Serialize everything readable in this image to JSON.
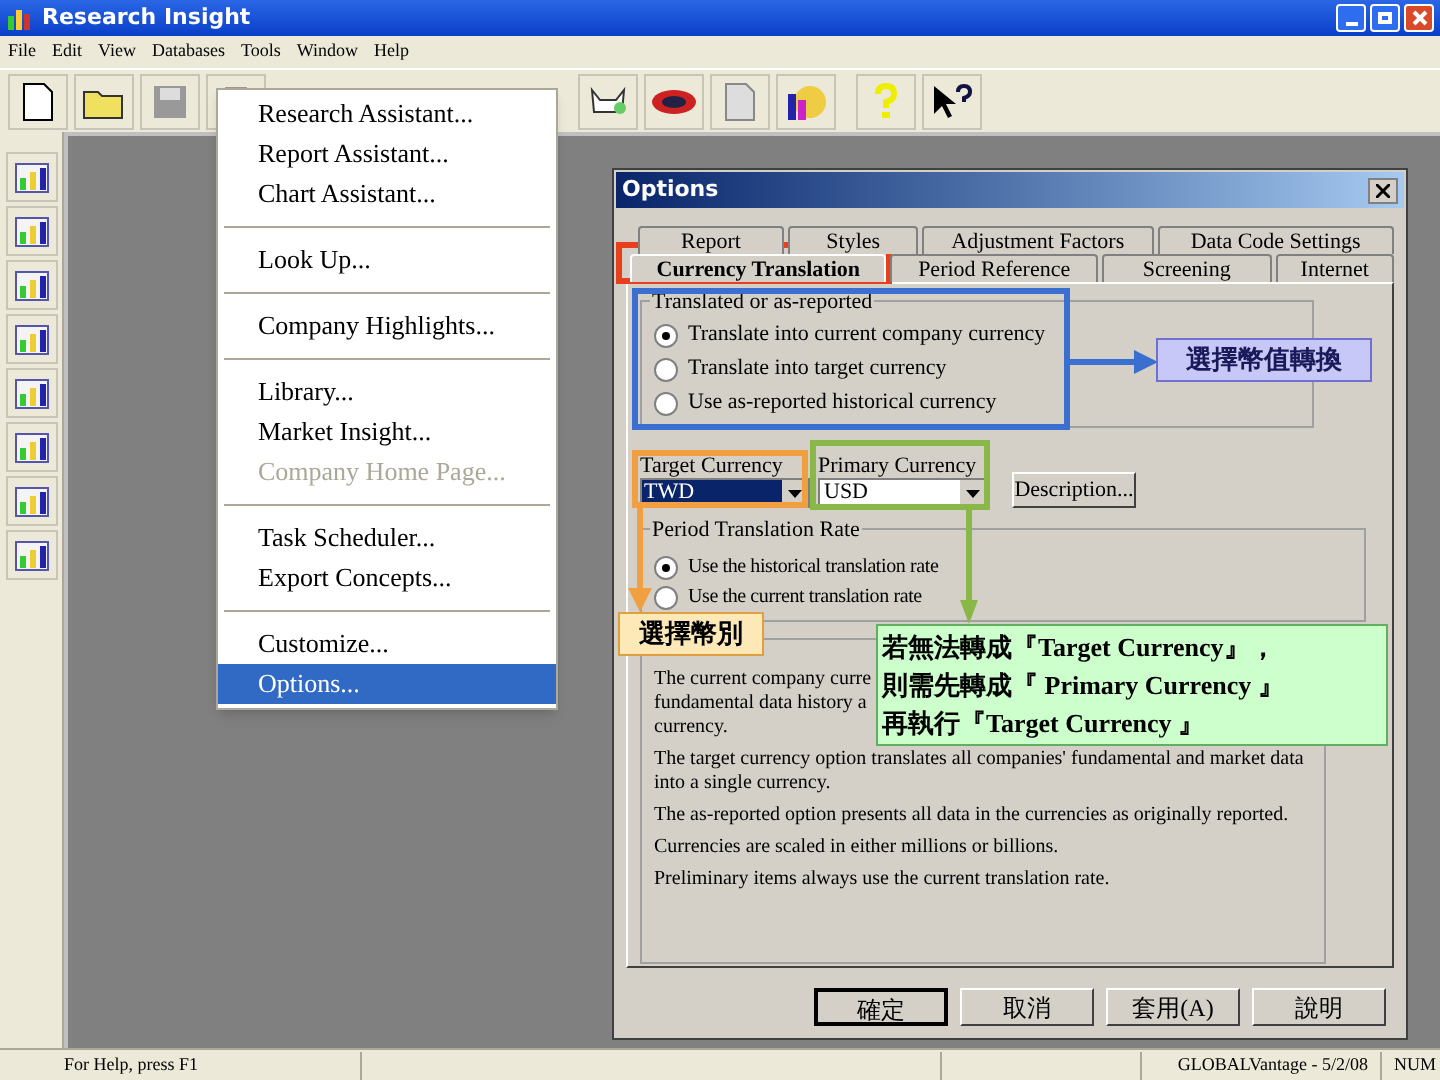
{
  "window": {
    "title": "Research Insight"
  },
  "menu_bar": [
    "File",
    "Edit",
    "View",
    "Databases",
    "Tools",
    "Window",
    "Help"
  ],
  "tools_menu": {
    "items": [
      {
        "kind": "item",
        "label": "Research Assistant...",
        "disabled": false,
        "selected": false
      },
      {
        "kind": "item",
        "label": "Report Assistant...",
        "disabled": false,
        "selected": false
      },
      {
        "kind": "item",
        "label": "Chart Assistant...",
        "disabled": false,
        "selected": false
      },
      {
        "kind": "separator"
      },
      {
        "kind": "item",
        "label": "Look Up...",
        "disabled": false,
        "selected": false
      },
      {
        "kind": "separator"
      },
      {
        "kind": "item",
        "label": "Company Highlights...",
        "disabled": false,
        "selected": false
      },
      {
        "kind": "separator"
      },
      {
        "kind": "item",
        "label": "Library...",
        "disabled": false,
        "selected": false
      },
      {
        "kind": "item",
        "label": "Market Insight...",
        "disabled": false,
        "selected": false
      },
      {
        "kind": "item",
        "label": "Company Home Page...",
        "disabled": true,
        "selected": false
      },
      {
        "kind": "separator"
      },
      {
        "kind": "item",
        "label": "Task Scheduler...",
        "disabled": false,
        "selected": false
      },
      {
        "kind": "item",
        "label": "Export Concepts...",
        "disabled": false,
        "selected": false
      },
      {
        "kind": "separator"
      },
      {
        "kind": "item",
        "label": "Customize...",
        "disabled": false,
        "selected": false
      },
      {
        "kind": "item",
        "label": "Options...",
        "disabled": false,
        "selected": true
      }
    ]
  },
  "options_dialog": {
    "title": "Options",
    "tab_rows": [
      [
        {
          "label": "Report",
          "selected": false
        },
        {
          "label": "Styles",
          "selected": false
        },
        {
          "label": "Adjustment Factors",
          "selected": false
        },
        {
          "label": "Data Code Settings",
          "selected": false
        }
      ],
      [
        {
          "label": "Currency Translation",
          "selected": true
        },
        {
          "label": "Period Reference",
          "selected": false
        },
        {
          "label": "Screening",
          "selected": false
        },
        {
          "label": "Internet",
          "selected": false
        }
      ]
    ],
    "translation_group": {
      "label": "Translated or as-reported",
      "options": [
        {
          "label": "Translate into current company currency",
          "selected": true
        },
        {
          "label": "Translate into target currency",
          "selected": false
        },
        {
          "label": "Use as-reported historical currency",
          "selected": false
        }
      ]
    },
    "target_currency": {
      "label": "Target Currency",
      "value": "TWD"
    },
    "primary_currency": {
      "label": "Primary Currency",
      "value": "USD"
    },
    "description_button": "Description...",
    "rate_group": {
      "label": "Period Translation Rate",
      "options": [
        {
          "label": "Use the historical translation rate",
          "selected": true
        },
        {
          "label": "Use the current translation rate",
          "selected": false
        }
      ]
    },
    "notes_first_lines": [
      "The current company curre",
      "fundamental data history a",
      "currency."
    ],
    "notes": [
      "The target currency option translates all companies' fundamental and market data into a single currency.",
      "The as-reported option presents all data in the currencies as originally reported.",
      "Currencies are scaled in either millions or billions.",
      "Preliminary items always use the current translation rate."
    ],
    "buttons": [
      {
        "label": "確定",
        "default": true
      },
      {
        "label": "取消",
        "default": false
      },
      {
        "label": "套用(A)",
        "default": false
      },
      {
        "label": "說明",
        "default": false
      }
    ]
  },
  "annotations": {
    "frames": [
      {
        "color": "#e8401c"
      },
      {
        "color": "#3a6fd0"
      },
      {
        "color": "#f0a040"
      },
      {
        "color": "#8ab848"
      }
    ],
    "callouts": [
      {
        "kind": "conversion",
        "text": "選擇幣值轉換"
      },
      {
        "kind": "currency",
        "text": "選擇幣別"
      },
      {
        "kind": "note",
        "lines": [
          "若無法轉成『Target Currency』，",
          "則需先轉成『 Primary Currency 』",
          "再執行『Target Currency 』"
        ]
      }
    ]
  },
  "status_bar": [
    "For Help, press F1",
    "GLOBALVantage - 5/2/08",
    "NUM"
  ]
}
